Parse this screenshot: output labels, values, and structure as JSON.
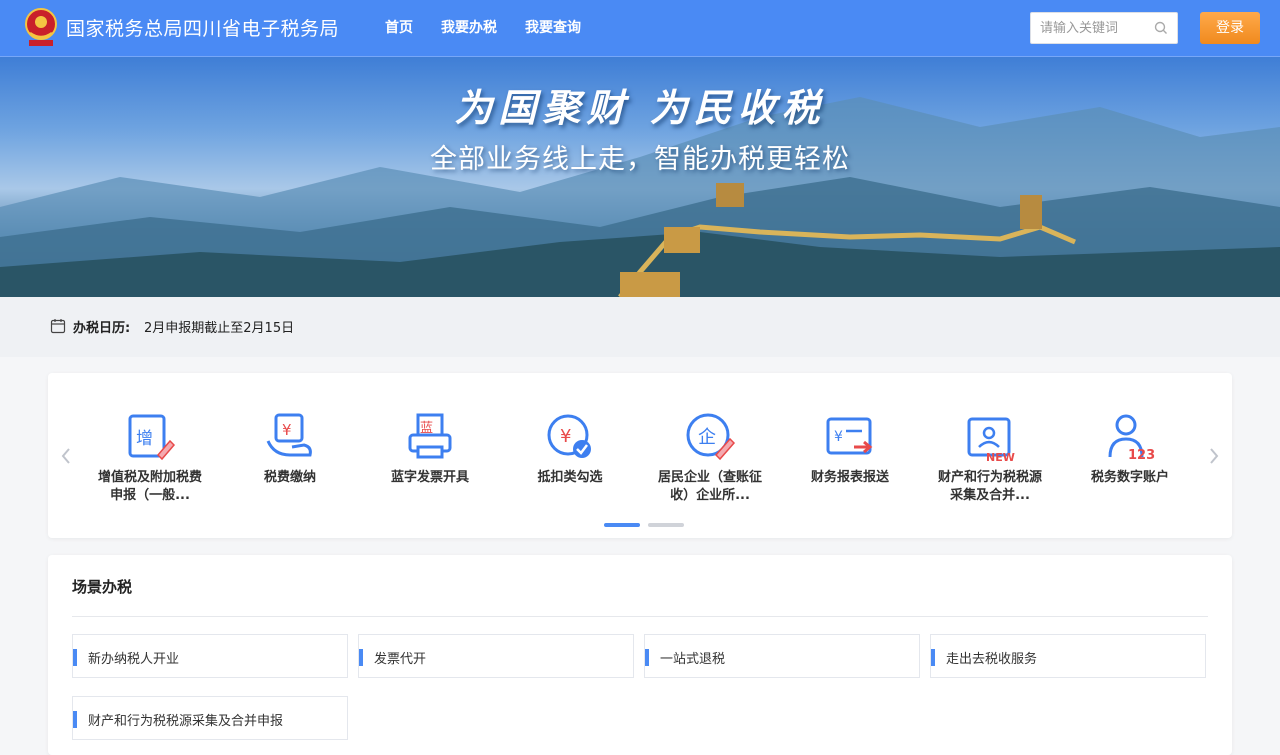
{
  "header": {
    "title": "国家税务总局四川省电子税务局",
    "nav": [
      "首页",
      "我要办税",
      "我要查询"
    ],
    "search_placeholder": "请输入关键词",
    "login_label": "登录"
  },
  "banner": {
    "slogan_main": "为国聚财  为民收税",
    "slogan_sub": "全部业务线上走，智能办税更轻松"
  },
  "calendar": {
    "label": "办税日历:",
    "text": "2月申报期截止至2月15日"
  },
  "quick_services": {
    "items": [
      {
        "label": "增值税及附加税费申报（一般...",
        "icon": "vat-icon"
      },
      {
        "label": "税费缴纳",
        "icon": "tax-payment-icon"
      },
      {
        "label": "蓝字发票开具",
        "icon": "invoice-printer-icon"
      },
      {
        "label": "抵扣类勾选",
        "icon": "deduction-check-icon"
      },
      {
        "label": "居民企业（查账征收）企业所...",
        "icon": "enterprise-icon"
      },
      {
        "label": "财务报表报送",
        "icon": "financial-report-icon"
      },
      {
        "label": "财产和行为税税源采集及合并...",
        "icon": "property-tax-new-icon"
      },
      {
        "label": "税务数字账户",
        "icon": "digital-account-icon"
      }
    ],
    "page_count": 2,
    "active_page": 1,
    "colors": {
      "active_dot": "#4a8af4",
      "inactive_dot": "#d0d3d9",
      "icon_blue": "#3d7ff0",
      "icon_red": "#e84a4a"
    }
  },
  "scenarios": {
    "title": "场景办税",
    "items": [
      "新办纳税人开业",
      "发票代开",
      "一站式退税",
      "走出去税收服务",
      "财产和行为税税源采集及合并申报"
    ]
  },
  "colors": {
    "header_bg": "#4a8af4",
    "login_btn": "#f79a30",
    "accent": "#4a8af4"
  }
}
